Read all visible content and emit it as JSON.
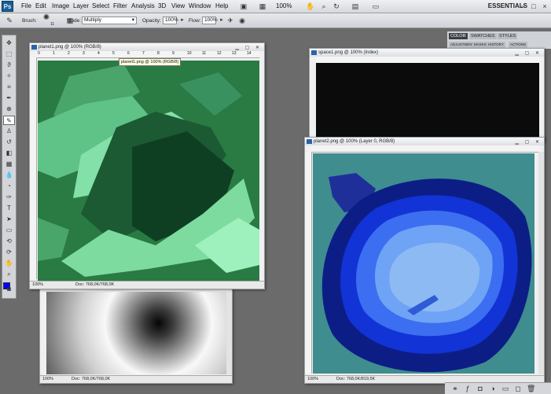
{
  "app": {
    "logo": "Ps",
    "workspace": "ESSENTIALS"
  },
  "menu": [
    "File",
    "Edit",
    "Image",
    "Layer",
    "Select",
    "Filter",
    "Analysis",
    "3D",
    "View",
    "Window",
    "Help"
  ],
  "appbar": {
    "zoom": "100%"
  },
  "options": {
    "brush_label": "Brush:",
    "brush_size": "11",
    "mode_label": "Mode:",
    "mode_value": "Multiply",
    "opacity_label": "Opacity:",
    "opacity_value": "100%",
    "flow_label": "Flow:",
    "flow_value": "100%"
  },
  "panels": {
    "tabs": [
      "COLOR",
      "SWATCHES",
      "STYLES"
    ],
    "subtabs": [
      "ADJUSTMENTS",
      "MASKS",
      "HISTORY",
      "ACTIONS"
    ]
  },
  "documents": [
    {
      "title": "planet1.png @ 100% (RGB/8)",
      "zoom": "100%",
      "doc": "Doc: 768,0K/768,0K"
    },
    {
      "title": "space1.png @ 100% (Index)"
    },
    {
      "title": "planet2.png @ 100% (Layer 0, RGB/8)",
      "zoom": "100%",
      "doc": "Doc: 768,0K/819,5K"
    },
    {
      "zoom": "100%",
      "doc": "Doc: 768,0K/768,0K"
    }
  ],
  "tooltip": "planet1.png @ 100% (RGB/8)",
  "ruler_ticks": [
    "0",
    "1",
    "2",
    "3",
    "4",
    "5",
    "6",
    "7",
    "8",
    "9",
    "10",
    "11",
    "12",
    "13",
    "14"
  ],
  "colors": {
    "foreground": "#0000ff",
    "background": "#ffffff"
  }
}
